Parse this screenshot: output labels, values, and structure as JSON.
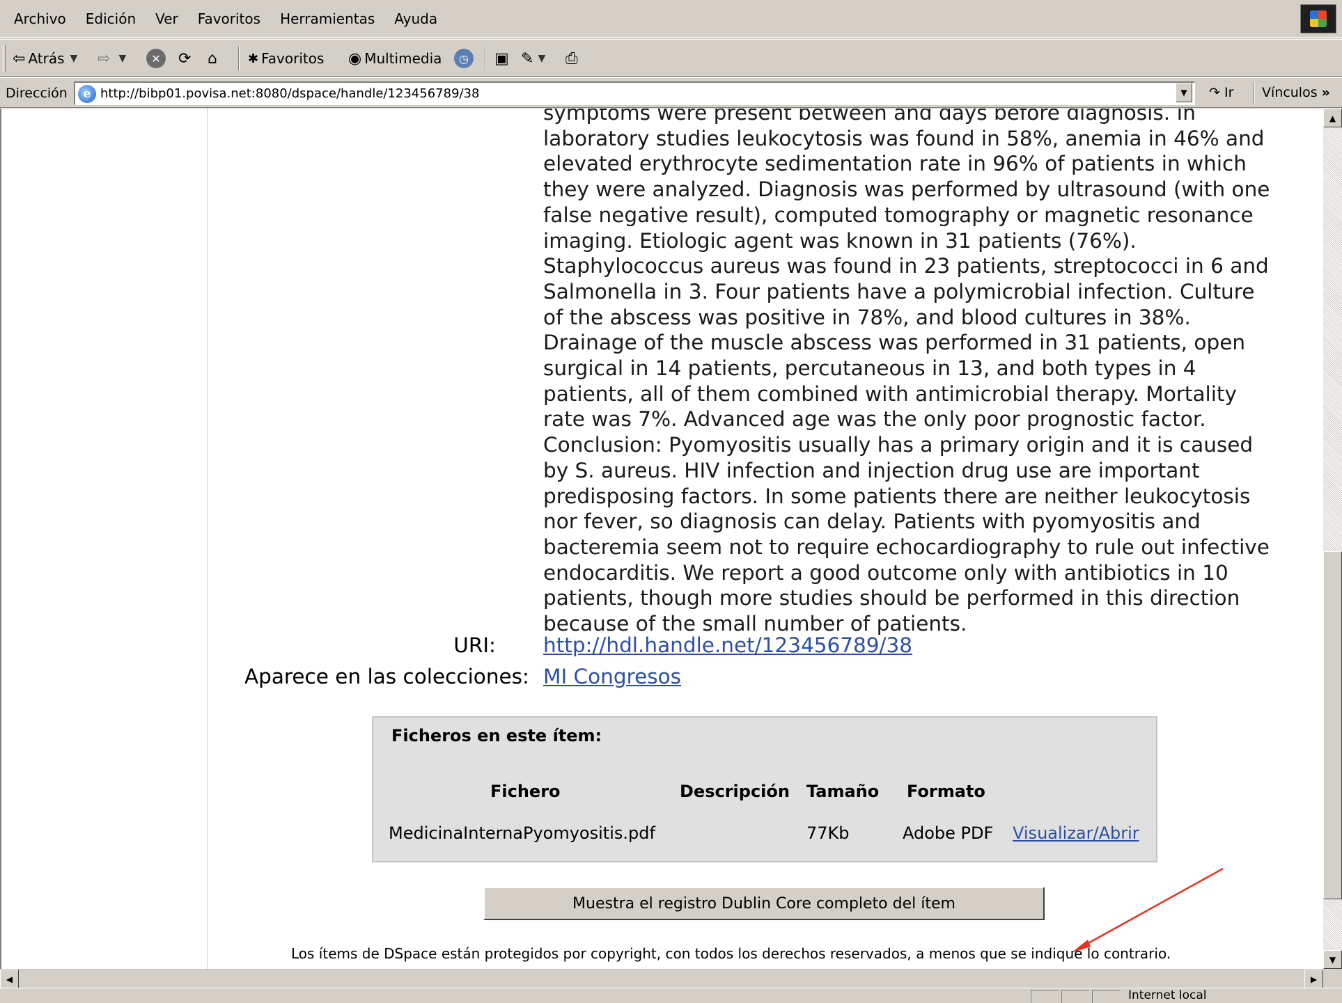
{
  "menu": [
    "Archivo",
    "Edición",
    "Ver",
    "Favoritos",
    "Herramientas",
    "Ayuda"
  ],
  "toolbar": {
    "back_label": "Atrás",
    "favorites_label": "Favoritos",
    "media_label": "Multimedia"
  },
  "address": {
    "label": "Dirección",
    "url": "http://bibp01.povisa.net:8080/dspace/handle/123456789/38",
    "go_label": "Ir",
    "links_label": "Vínculos"
  },
  "abstract_lines": [
    "symptoms were present between and days before diagnosis. In",
    "laboratory studies leukocytosis was found in 58%, anemia in 46% and",
    "elevated erythrocyte sedimentation rate in 96% of patients in which",
    "they were analyzed. Diagnosis was performed by ultrasound (with one",
    "false negative result), computed tomography or magnetic resonance",
    "imaging. Etiologic agent was known in 31 patients (76%).",
    "Staphylococcus aureus was found in 23 patients, streptococci in 6 and",
    "Salmonella in 3. Four patients have a polymicrobial infection. Culture",
    "of the abscess was positive in 78%, and blood cultures in 38%.",
    "Drainage of the muscle abscess was performed in 31 patients, open",
    "surgical in 14 patients, percutaneous in 13, and both types in 4",
    "patients, all of them combined with antimicrobial therapy. Mortality",
    "rate was 7%. Advanced age was the only poor prognostic factor.",
    "Conclusion: Pyomyositis usually has a primary origin and it is caused",
    "by S. aureus. HIV infection and injection drug use are important",
    "predisposing factors. In some patients there are neither leukocytosis",
    "nor fever, so diagnosis can delay. Patients with pyomyositis and",
    "bacteremia seem not to require echocardiography to rule out infective",
    "endocarditis. We report a good outcome only with antibiotics in 10",
    "patients, though more studies should be performed in this direction",
    "because of the small number of patients."
  ],
  "uri": {
    "label": "URI:",
    "value": "http://hdl.handle.net/123456789/38"
  },
  "collections": {
    "label": "Aparece en las colecciones:",
    "value": "MI Congresos"
  },
  "files": {
    "title": "Ficheros en este ítem:",
    "headers": [
      "Fichero",
      "Descripción",
      "Tamaño",
      "Formato"
    ],
    "rows": [
      {
        "name": "MedicinaInternaPyomyositis.pdf",
        "description": "",
        "size": "77Kb",
        "format": "Adobe PDF",
        "action": "Visualizar/Abrir"
      }
    ]
  },
  "dublin_core_button": "Muestra el registro Dublin Core completo del ítem",
  "footer_note": "Los ítems de DSpace están protegidos por copyright, con todos los derechos reservados, a menos que se indique lo contrario.",
  "status": {
    "zone": "Internet local"
  },
  "colors": {
    "link": "#2d4fa3",
    "annotation_arrow": "#e8321e",
    "chrome": "#d4d0c8"
  }
}
